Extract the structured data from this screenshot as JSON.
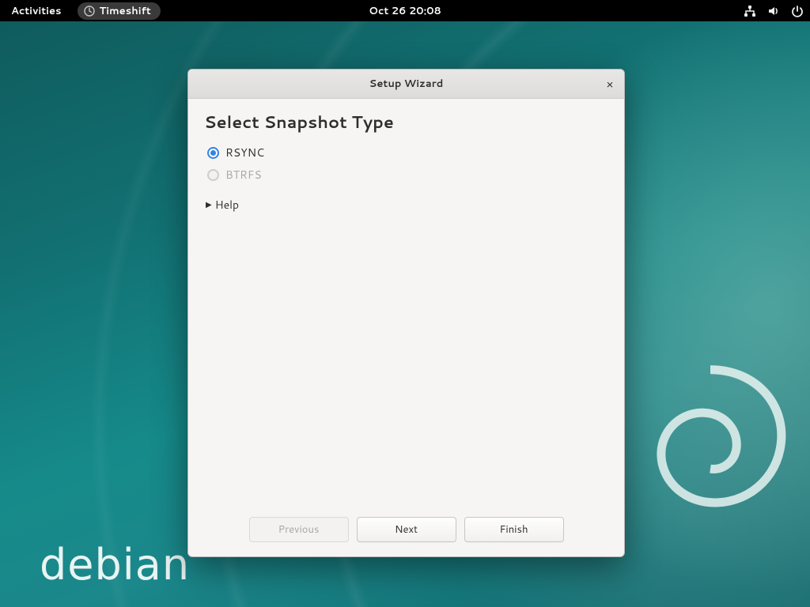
{
  "topbar": {
    "activities_label": "Activities",
    "app_name": "Timeshift",
    "clock": "Oct 26  20:08"
  },
  "desktop": {
    "distro_wordmark": "debian"
  },
  "window": {
    "title": "Setup Wizard",
    "heading": "Select Snapshot Type",
    "options": {
      "rsync": {
        "label": "RSYNC",
        "selected": true,
        "enabled": true
      },
      "btrfs": {
        "label": "BTRFS",
        "selected": false,
        "enabled": false
      }
    },
    "expander_label": "Help",
    "buttons": {
      "previous": {
        "label": "Previous",
        "enabled": false
      },
      "next": {
        "label": "Next",
        "enabled": true
      },
      "finish": {
        "label": "Finish",
        "enabled": true
      }
    }
  },
  "icons": {
    "app": "clock-icon",
    "network": "network-wired-icon",
    "volume": "volume-icon",
    "power": "power-icon",
    "close": "close-icon",
    "expander": "triangle-right-icon",
    "swirl": "debian-swirl-icon"
  }
}
